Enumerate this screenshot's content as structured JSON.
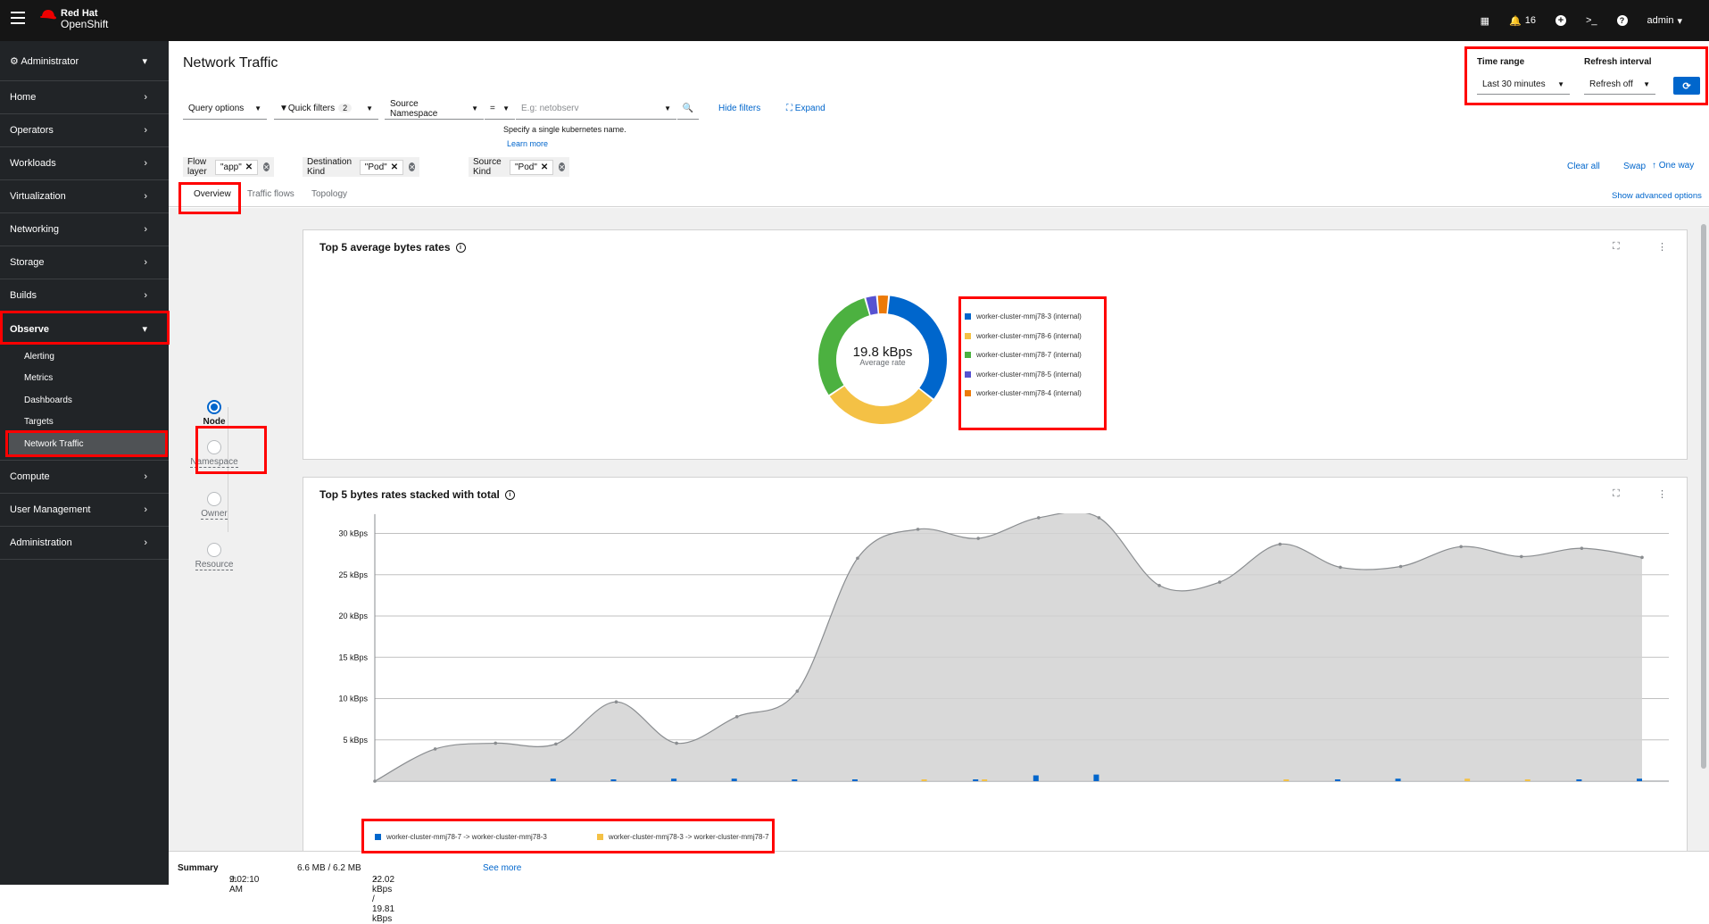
{
  "masthead": {
    "brand_line1": "Red Hat",
    "brand_line2": "OpenShift",
    "notifications_count": "16",
    "user": "admin"
  },
  "sidebar": {
    "perspective": "Administrator",
    "items": [
      {
        "label": "Home"
      },
      {
        "label": "Operators"
      },
      {
        "label": "Workloads"
      },
      {
        "label": "Virtualization"
      },
      {
        "label": "Networking"
      },
      {
        "label": "Storage"
      },
      {
        "label": "Builds"
      },
      {
        "label": "Observe"
      },
      {
        "label": "Compute"
      },
      {
        "label": "User Management"
      },
      {
        "label": "Administration"
      }
    ],
    "observe_sub": [
      {
        "label": "Alerting"
      },
      {
        "label": "Metrics"
      },
      {
        "label": "Dashboards"
      },
      {
        "label": "Targets"
      },
      {
        "label": "Network Traffic"
      }
    ]
  },
  "page": {
    "title": "Network Traffic"
  },
  "time_controls": {
    "time_range_label": "Time range",
    "time_range_value": "Last 30 minutes",
    "refresh_label": "Refresh interval",
    "refresh_value": "Refresh off"
  },
  "filters": {
    "query_options": "Query options",
    "quick_filters": "Quick filters",
    "quick_filters_count": "2",
    "source_namespace": "Source Namespace",
    "equals": "=",
    "search_placeholder": "E.g: netobserv",
    "hint": "Specify a single kubernetes name.",
    "learn_more": "Learn more",
    "hide_filters": "Hide filters",
    "expand": "Expand"
  },
  "chips": [
    {
      "category": "Flow layer",
      "value": "\"app\""
    },
    {
      "category": "Destination Kind",
      "value": "\"Pod\""
    },
    {
      "category": "Source Kind",
      "value": "\"Pod\""
    }
  ],
  "chip_actions": {
    "clear_all": "Clear all",
    "swap": "Swap",
    "one_way": "One way"
  },
  "tabs": [
    {
      "label": "Overview"
    },
    {
      "label": "Traffic flows"
    },
    {
      "label": "Topology"
    }
  ],
  "show_advanced": "Show advanced options",
  "scope": [
    {
      "label": "Node"
    },
    {
      "label": "Namespace"
    },
    {
      "label": "Owner"
    },
    {
      "label": "Resource"
    }
  ],
  "donut_card": {
    "title": "Top 5 average bytes rates",
    "center_value": "19.8 kBps",
    "center_label": "Average rate",
    "legend": [
      {
        "name": "worker-cluster-mmj78-3 (internal)",
        "color": "#0066cc"
      },
      {
        "name": "worker-cluster-mmj78-6 (internal)",
        "color": "#f4c145"
      },
      {
        "name": "worker-cluster-mmj78-7 (internal)",
        "color": "#4cb140"
      },
      {
        "name": "worker-cluster-mmj78-5 (internal)",
        "color": "#5752d1"
      },
      {
        "name": "worker-cluster-mmj78-4 (internal)",
        "color": "#ec7a08"
      }
    ]
  },
  "stacked_card": {
    "title": "Top 5 bytes rates stacked with total",
    "legend": [
      {
        "name": "worker-cluster-mmj78-7 -> worker-cluster-mmj78-3",
        "color": "#0066cc"
      },
      {
        "name": "worker-cluster-mmj78-3 -> worker-cluster-mmj78-7",
        "color": "#f4c145"
      }
    ]
  },
  "chart_data": [
    {
      "type": "pie",
      "title": "Top 5 average bytes rates",
      "categories": [
        "worker-cluster-mmj78-3 (internal)",
        "worker-cluster-mmj78-6 (internal)",
        "worker-cluster-mmj78-7 (internal)",
        "worker-cluster-mmj78-5 (internal)",
        "worker-cluster-mmj78-4 (internal)"
      ],
      "values": [
        34,
        30,
        30,
        3,
        3
      ],
      "colors": [
        "#0066cc",
        "#f4c145",
        "#4cb140",
        "#5752d1",
        "#ec7a08"
      ]
    },
    {
      "type": "area",
      "title": "Top 5 bytes rates stacked with total",
      "yticks": [
        "5 kBps",
        "10 kBps",
        "15 kBps",
        "20 kBps",
        "25 kBps",
        "30 kBps"
      ],
      "ylim": [
        0,
        32
      ],
      "grid": true,
      "series": [
        {
          "name": "Total",
          "values": [
            0,
            3.9,
            4.6,
            4.5,
            9.6,
            4.6,
            7.8,
            10.9,
            27.0,
            30.5,
            29.4,
            31.9,
            31.9,
            23.7,
            24.1,
            28.7,
            25.9,
            26.0,
            28.4,
            27.2,
            28.2,
            27.1
          ]
        },
        {
          "name": "worker-cluster-mmj78-7 -> worker-cluster-mmj78-3",
          "values": [
            0,
            0,
            0,
            0.3,
            0.2,
            0.3,
            0.3,
            0.2,
            0.1,
            0,
            0.1,
            0.7,
            0.8,
            0,
            0,
            0,
            0.2,
            0.3,
            0,
            0,
            0.2,
            0.3
          ]
        },
        {
          "name": "worker-cluster-mmj78-3 -> worker-cluster-mmj78-7",
          "values": [
            0,
            0,
            0,
            0,
            0,
            0,
            0,
            0,
            0,
            0.1,
            0.2,
            0,
            0,
            0,
            0,
            0.2,
            0,
            0,
            0.3,
            0.2,
            0,
            0
          ]
        }
      ]
    }
  ],
  "summary": {
    "label": "Summary",
    "time": "9:02:10 AM",
    "size": "6.6 MB / 6.2 MB",
    "rate": "22.02 kBps / 19.81 kBps",
    "see_more": "See more"
  }
}
